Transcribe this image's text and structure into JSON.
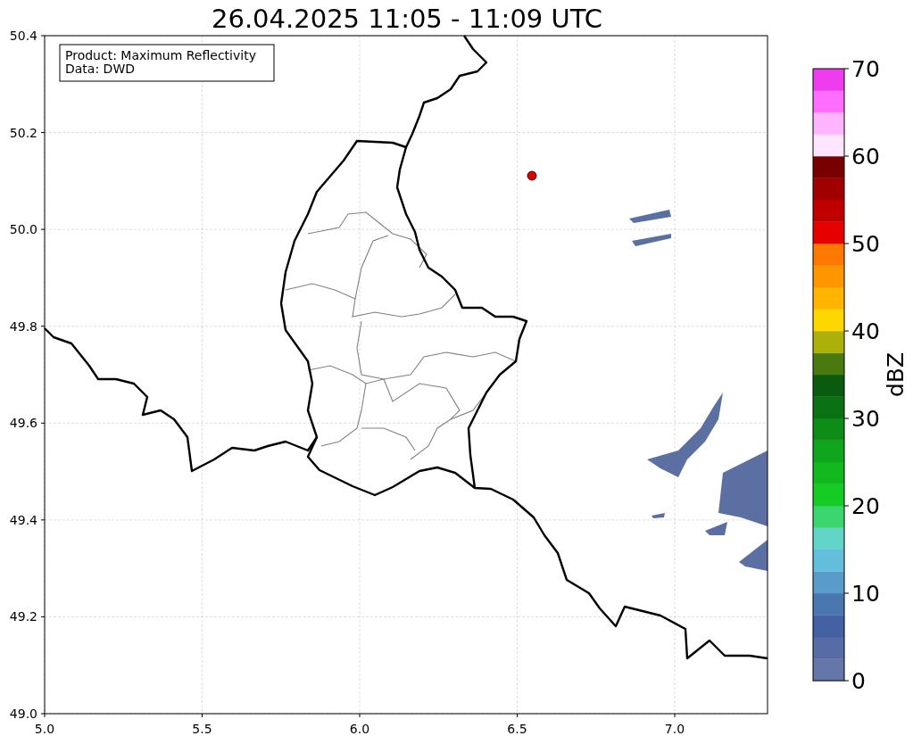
{
  "title": "26.04.2025 11:05 - 11:09 UTC",
  "info_box": {
    "lines": [
      "Product: Maximum Reflectivity",
      "Data: DWD"
    ]
  },
  "map": {
    "x_ticks": [
      "5.0",
      "5.5",
      "6.0",
      "6.5",
      "7.0"
    ],
    "y_ticks": [
      "50.4",
      "50.2",
      "50.0",
      "49.8",
      "49.6",
      "49.4",
      "49.2",
      "49.0"
    ]
  },
  "colorbar": {
    "label": "dBZ",
    "ticks": [
      "70",
      "60",
      "50",
      "40",
      "30",
      "20",
      "10",
      "0"
    ],
    "segments": [
      {
        "color": "#6577a8"
      },
      {
        "color": "#576ca6"
      },
      {
        "color": "#4461a3"
      },
      {
        "color": "#4a77b0"
      },
      {
        "color": "#5a9cc9"
      },
      {
        "color": "#62bedc"
      },
      {
        "color": "#62d4c8"
      },
      {
        "color": "#3dd570"
      },
      {
        "color": "#14cc23"
      },
      {
        "color": "#11b81e"
      },
      {
        "color": "#0fa51c"
      },
      {
        "color": "#0d8c17"
      },
      {
        "color": "#0b7214"
      },
      {
        "color": "#0a5a10"
      },
      {
        "color": "#4a7a0f"
      },
      {
        "color": "#aeb00a"
      },
      {
        "color": "#ffd700"
      },
      {
        "color": "#ffb400"
      },
      {
        "color": "#ff9600"
      },
      {
        "color": "#ff7800"
      },
      {
        "color": "#e60000"
      },
      {
        "color": "#c00000"
      },
      {
        "color": "#a00000"
      },
      {
        "color": "#780000"
      },
      {
        "color": "#ffe4ff"
      },
      {
        "color": "#ffb4ff"
      },
      {
        "color": "#ff6eff"
      },
      {
        "color": "#ee3cee"
      }
    ]
  }
}
